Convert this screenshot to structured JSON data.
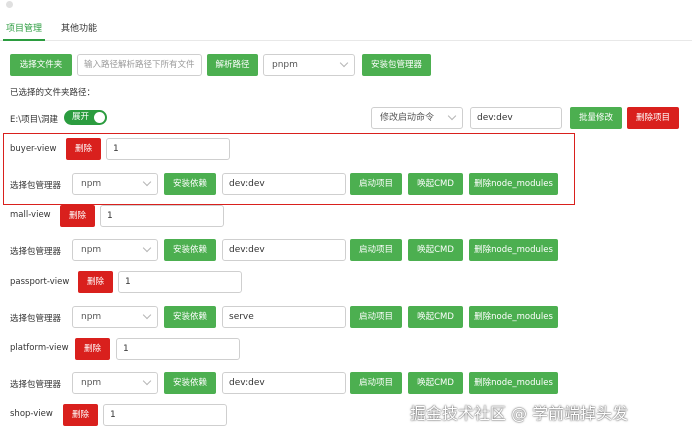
{
  "tabs": [
    {
      "label": "项目管理",
      "active": true
    },
    {
      "label": "其他功能",
      "active": false
    }
  ],
  "toolbar": {
    "choose_folder": "选择文件夹",
    "path_placeholder": "输入路径解析路径下所有文件",
    "parse_path": "解析路径",
    "pm_selected": "pnpm",
    "install_pm": "安装包管理器"
  },
  "selected_label": "已选择的文件夹路径：",
  "folder": {
    "path": "E:\\项目\\洞建",
    "toggle_label": "展开",
    "modify_cmd_placeholder": "修改启动命令",
    "cmd_value": "dev:dev",
    "batch_modify": "批量修改",
    "delete_project": "删除项目"
  },
  "labels": {
    "delete": "删除",
    "pm_label": "选择包管理器",
    "install_deps": "安装依赖",
    "start": "启动项目",
    "cmd": "唤起CMD",
    "remove_nm": "删除node_modules"
  },
  "projects": [
    {
      "name": "buyer-view",
      "count": "1",
      "pm": "npm",
      "cmd": "dev:dev"
    },
    {
      "name": "mall-view",
      "count": "1",
      "pm": "npm",
      "cmd": "dev:dev"
    },
    {
      "name": "passport-view",
      "count": "1",
      "pm": "npm",
      "cmd": "serve"
    },
    {
      "name": "platform-view",
      "count": "1",
      "pm": "npm",
      "cmd": "dev:dev"
    },
    {
      "name": "shop-view",
      "count": "1"
    }
  ],
  "watermark": "掘金技术社区 @ 学前端掉头发",
  "colors": {
    "green": "#4caf50",
    "accent": "#2b9c3f",
    "red": "#d9201d"
  }
}
